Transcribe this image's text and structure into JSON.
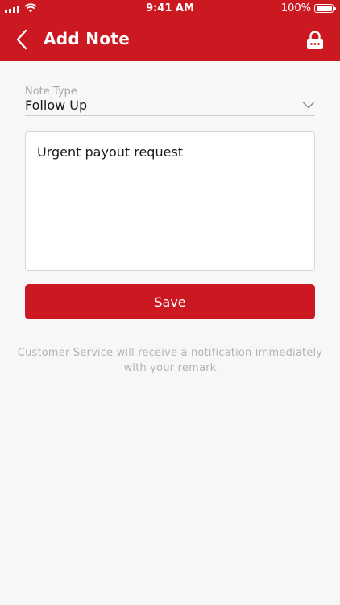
{
  "status_bar": {
    "time": "9:41 AM",
    "battery_percent": "100%",
    "battery_level": 1.0
  },
  "nav": {
    "title": "Add Note",
    "back_icon": "chevron-left-icon",
    "lock_icon": "lock-icon"
  },
  "form": {
    "note_type_label": "Note Type",
    "note_type_value": "Follow Up",
    "remark_value": "Urgent payout request",
    "save_label": "Save"
  },
  "info": {
    "line1": "Customer Service will receive a notification immediately",
    "line2": "with your remark"
  },
  "colors": {
    "brand": "#cc1820",
    "background": "#f7f7f7",
    "hint_text": "#b3b3b3"
  }
}
